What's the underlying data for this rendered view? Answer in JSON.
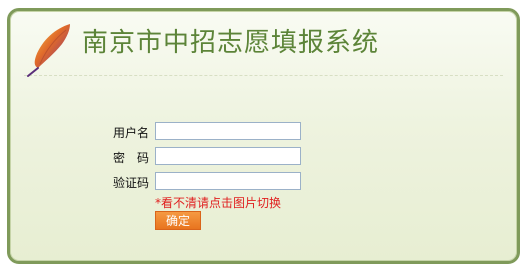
{
  "header": {
    "title": "南京市中招志愿填报系统",
    "logo_icon": "feather-icon"
  },
  "form": {
    "username": {
      "label": "用户名",
      "value": ""
    },
    "password": {
      "label": "密　码",
      "value": ""
    },
    "captcha": {
      "label": "验证码",
      "value": ""
    },
    "captcha_hint": "*看不清请点击图片切换",
    "submit_label": "确定"
  },
  "colors": {
    "panel_border": "#7f9a5a",
    "title_green": "#5c8438",
    "hint_red": "#e02020",
    "button_orange": "#e8741f"
  }
}
